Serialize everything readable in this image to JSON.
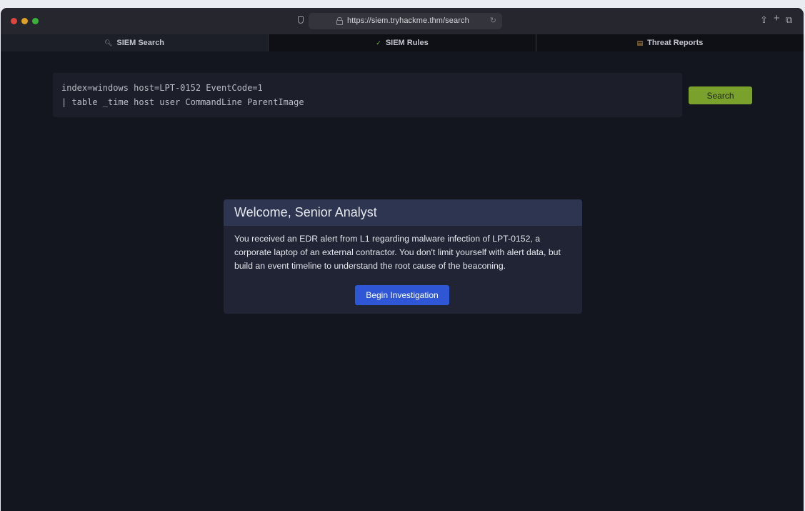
{
  "browser": {
    "url": "https://siem.tryhackme.thm/search",
    "traffic_light_colors": [
      "#e0443e",
      "#dea123",
      "#3bb03a"
    ]
  },
  "tabs": [
    {
      "label": "SIEM Search",
      "icon": "magnifier-icon",
      "active": true
    },
    {
      "label": "SIEM Rules",
      "icon": "shield-check-icon",
      "active": false
    },
    {
      "label": "Threat Reports",
      "icon": "document-icon",
      "active": false
    }
  ],
  "search": {
    "query_line_1": "index=windows host=LPT-0152 EventCode=1",
    "query_line_2": "| table _time host user CommandLine ParentImage",
    "button_label": "Search",
    "button_color": "#79a12c"
  },
  "modal": {
    "title": "Welcome, Senior Analyst",
    "body": "You received an EDR alert from L1 regarding malware infection of LPT-0152, a corporate laptop of an external contractor. You don't limit yourself with alert data, but build an event timeline to understand the root cause of the beaconing.",
    "button_label": "Begin Investigation",
    "button_color": "#2f56d5"
  }
}
